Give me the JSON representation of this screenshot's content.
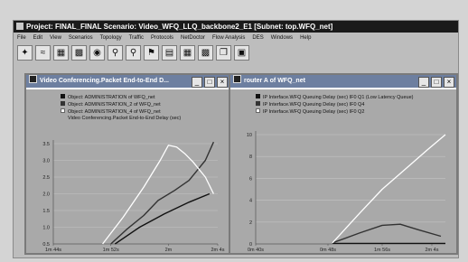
{
  "app": {
    "title": "Project: FINAL_FINAL Scenario: Video_WFQ_LLQ_backbone2_E1  [Subnet: top.WFQ_net]"
  },
  "menu": [
    "File",
    "Edit",
    "View",
    "Scenarios",
    "Topology",
    "Traffic",
    "Protocols",
    "NetDoctor",
    "Flow Analysis",
    "DES",
    "Windows",
    "Help"
  ],
  "toolbar": [
    "node-tool-icon",
    "link-tool-icon",
    "subnet-tool-icon",
    "config-tool-icon",
    "failure-tool-icon",
    "zoom-in-icon",
    "zoom-out-icon",
    "flag-icon",
    "results-icon",
    "statistics-icon",
    "web-report-icon",
    "scenarios-icon",
    "animation-icon"
  ],
  "colors": {
    "title_bar": "#6d7fa0",
    "plot_bg": "#a9a9a9"
  },
  "left_window": {
    "title": "Video Conferencing.Packet End-to-End D...",
    "legend": [
      {
        "label": "Object: ADMINISTRATION of WFQ_net",
        "color": "#111111"
      },
      {
        "label": "Object: ADMINISTRATION_2 of WFQ_net",
        "color": "#333333"
      },
      {
        "label": "Object: ADMINISTRATION_4 of WFQ_net",
        "color": "#ffffff"
      }
    ],
    "subtitle": "Video Conferencing.Packet End-to-End Delay (sec)"
  },
  "right_window": {
    "title": "router A of WFQ_net",
    "legend": [
      {
        "label": "IP Interface.WFQ Queuing Delay (sec) IF0 Q1 (Low Latency Queue)",
        "color": "#111111"
      },
      {
        "label": "IP Interface.WFQ Queuing Delay (sec) IF0 Q4",
        "color": "#333333"
      },
      {
        "label": "IP Interface.WFQ Queuing Delay (sec) IF0 Q2",
        "color": "#ffffff"
      }
    ]
  },
  "chart_data": [
    {
      "type": "line",
      "ylim": [
        0.5,
        3.5
      ],
      "yticks": [
        "0.5",
        "1.0",
        "1.5",
        "2.0",
        "2.5",
        "3.0",
        "3.5"
      ],
      "xlim": [
        44,
        124
      ],
      "xticks": [
        {
          "v": 44,
          "label": "1m 44s"
        },
        {
          "v": 72,
          "label": "1m 52s"
        },
        {
          "v": 100,
          "label": "2m"
        },
        {
          "v": 124,
          "label": "2m 4s"
        }
      ],
      "series": [
        {
          "name": "Object: ADMINISTRATION of WFQ_net",
          "color": "#111111",
          "width": 1.4,
          "x": [
            74,
            86,
            98,
            110,
            120
          ],
          "y": [
            0.5,
            1.0,
            1.4,
            1.75,
            2.0
          ]
        },
        {
          "name": "Object: ADMINISTRATION_2 of WFQ_net",
          "color": "#333333",
          "width": 1.4,
          "x": [
            72,
            80,
            88,
            95,
            103,
            110,
            114,
            118,
            122
          ],
          "y": [
            0.5,
            0.95,
            1.35,
            1.8,
            2.1,
            2.4,
            2.7,
            3.0,
            3.55
          ]
        },
        {
          "name": "Object: ADMINISTRATION_4 of WFQ_net",
          "color": "#ffffff",
          "width": 1.3,
          "x": [
            68,
            78,
            88,
            96,
            100,
            104,
            108,
            112,
            118,
            122
          ],
          "y": [
            0.5,
            1.3,
            2.2,
            3.0,
            3.45,
            3.4,
            3.2,
            2.95,
            2.5,
            2.0
          ]
        }
      ]
    },
    {
      "type": "line",
      "ylim": [
        0,
        10
      ],
      "yticks": [
        "0",
        "2",
        "4",
        "6",
        "8",
        "10"
      ],
      "xlim": [
        40,
        124
      ],
      "xticks": [
        {
          "v": 40,
          "label": "0m 40s"
        },
        {
          "v": 72,
          "label": "0m 48s"
        },
        {
          "v": 96,
          "label": "1m 56s"
        },
        {
          "v": 118,
          "label": "2m 4s"
        }
      ],
      "series": [
        {
          "name": "IP Interface.WFQ Queuing Delay (sec) IF0 Q1 (Low Latency Queue)",
          "color": "#111111",
          "width": 1.2,
          "x": [
            74,
            124
          ],
          "y": [
            0.05,
            0.05
          ]
        },
        {
          "name": "IP Interface.WFQ Queuing Delay (sec) IF0 Q4",
          "color": "#333333",
          "width": 1.4,
          "x": [
            74,
            86,
            96,
            104,
            112,
            122
          ],
          "y": [
            0.1,
            1.0,
            1.7,
            1.8,
            1.3,
            0.7
          ]
        },
        {
          "name": "IP Interface.WFQ Queuing Delay (sec) IF0 Q2",
          "color": "#ffffff",
          "width": 1.3,
          "x": [
            74,
            86,
            96,
            106,
            116,
            124
          ],
          "y": [
            0.1,
            2.8,
            5.0,
            6.8,
            8.6,
            10.0
          ]
        }
      ]
    }
  ]
}
